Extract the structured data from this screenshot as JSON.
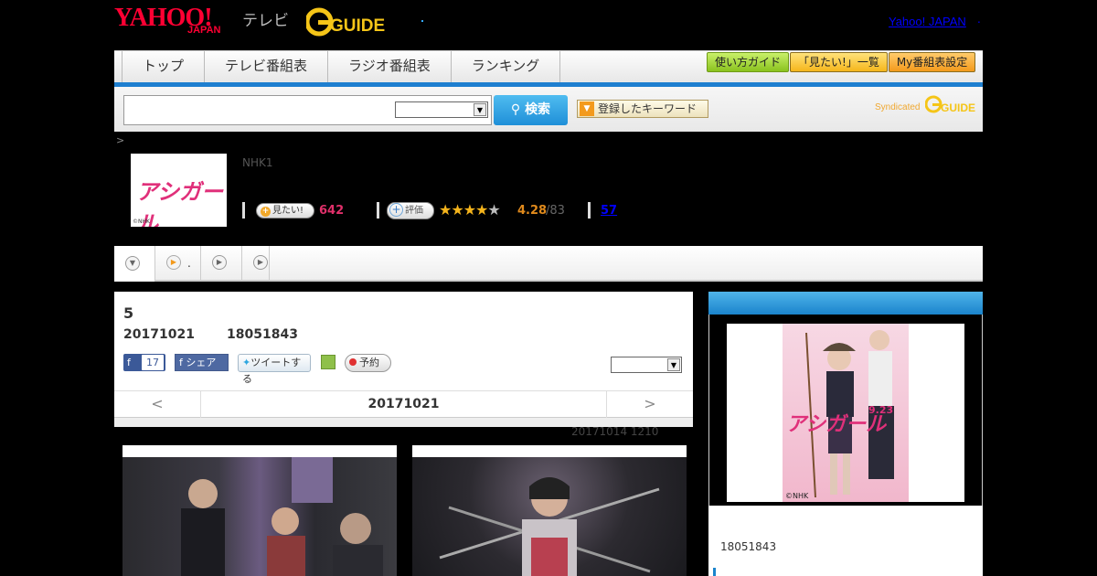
{
  "header": {
    "logo_yahoo": "YAHOO!",
    "logo_japan": "JAPAN",
    "logo_tv": "テレビ",
    "logo_gguide": "G-GUIDE",
    "yahoo_link": "Yahoo! JAPAN",
    "yahoo_dot": "."
  },
  "nav": {
    "tabs": [
      "トップ",
      "テレビ番組表",
      "ラジオ番組表",
      "ランキング"
    ],
    "buttons": [
      "使い方ガイド",
      "「見たい!」一覧",
      "My番組表設定"
    ]
  },
  "search": {
    "placeholder": "",
    "button_label": "検索",
    "keyword_button": "登録したキーワード",
    "syndicated": "Syndicated",
    "syn_logo": "GUIDE"
  },
  "breadcrumb": ">",
  "program": {
    "thumb_title": "アシガール",
    "thumb_copyright": "©NHK",
    "channel": "NHK1",
    "mitai_label": "見たい!",
    "mitai_count": "642",
    "rate_label": "評価",
    "rating": 4.28,
    "rating_score": "4.28",
    "rating_count": "/83",
    "comment_count": "57"
  },
  "subtabs": {
    "dot": "."
  },
  "episode": {
    "title": "5",
    "date": "20171021",
    "code": "18051843",
    "fb_count": "17",
    "fb_share": "シェア",
    "tweet": "ツイートする",
    "reserve": "予約",
    "pager_prev": "<",
    "pager_date": "20171021",
    "pager_next": ">",
    "original_air": "20171014  1210"
  },
  "sidebar": {
    "poster_title": "アシガール",
    "poster_date": "9.23",
    "poster_copyright": "©NHK",
    "code": "18051843"
  },
  "colors": {
    "accent_blue": "#1e7fd0",
    "brand_red": "#ff0033",
    "pink": "#e0307a"
  }
}
